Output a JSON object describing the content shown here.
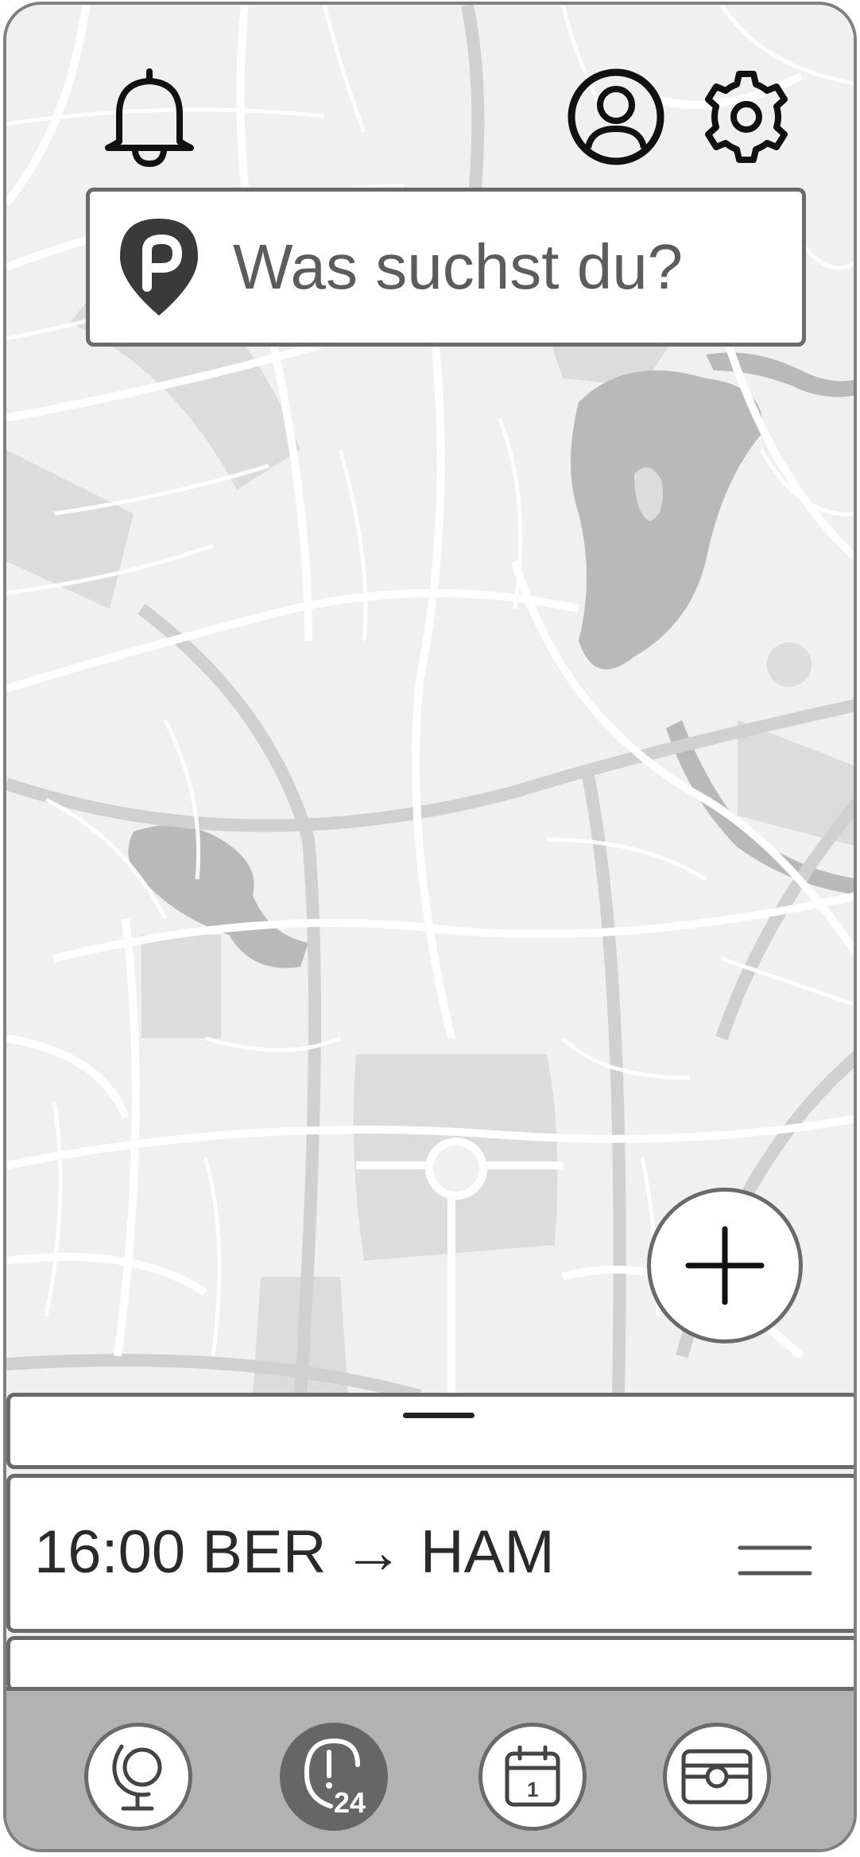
{
  "search": {
    "placeholder": "Was suchst du?"
  },
  "trip": {
    "summary": "16:00 BER → HAM"
  },
  "icons": {
    "notification": "bell-icon",
    "profile": "user-circle-icon",
    "settings": "gear-icon",
    "brand": "parking-pin-logo",
    "add": "plus-icon",
    "drag": "drag-handle-icon",
    "nav": [
      "globe-icon",
      "alert-24-icon",
      "calendar-icon",
      "ticket-icon"
    ]
  },
  "nav": {
    "active_index": 1
  },
  "colors": {
    "map_background": "#f0f0f0",
    "border": "#6a6a6a",
    "navbar": "#b2b2b2",
    "active_nav": "#666666"
  }
}
